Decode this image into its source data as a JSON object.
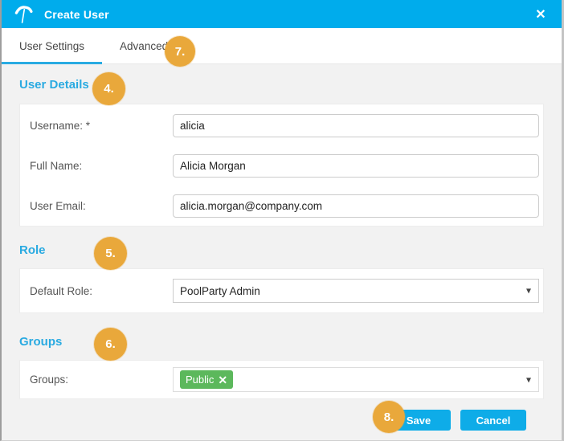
{
  "dialog": {
    "title": "Create User",
    "logo_icon": "poolparty-umbrella-icon",
    "close_icon": "✕"
  },
  "tabs": [
    {
      "label": "User Settings",
      "active": true
    },
    {
      "label": "Advanced",
      "active": false
    }
  ],
  "badges": {
    "user_details": "4.",
    "role": "5.",
    "groups": "6.",
    "advanced": "7.",
    "footer": "8."
  },
  "sections": {
    "user_details": {
      "heading": "User Details",
      "fields": [
        {
          "label": "Username: *",
          "value": "alicia"
        },
        {
          "label": "Full Name:",
          "value": "Alicia Morgan"
        },
        {
          "label": "User Email:",
          "value": "alicia.morgan@company.com"
        }
      ]
    },
    "role": {
      "heading": "Role",
      "label": "Default Role:",
      "selected_value": "PoolParty Admin"
    },
    "groups": {
      "heading": "Groups",
      "label": "Groups:",
      "tag": "Public",
      "tag_remove_icon": "✕"
    }
  },
  "icons": {
    "caret": "▾"
  },
  "footer": {
    "save_label": "Save",
    "cancel_label": "Cancel"
  },
  "colors": {
    "header_bg": "#00acec",
    "accent_cyan": "#29aae1",
    "button_bg": "#0eace8",
    "badge_orange": "#e9a83b",
    "tag_green": "#5cb85c",
    "body_bg": "#f2f2f2"
  }
}
